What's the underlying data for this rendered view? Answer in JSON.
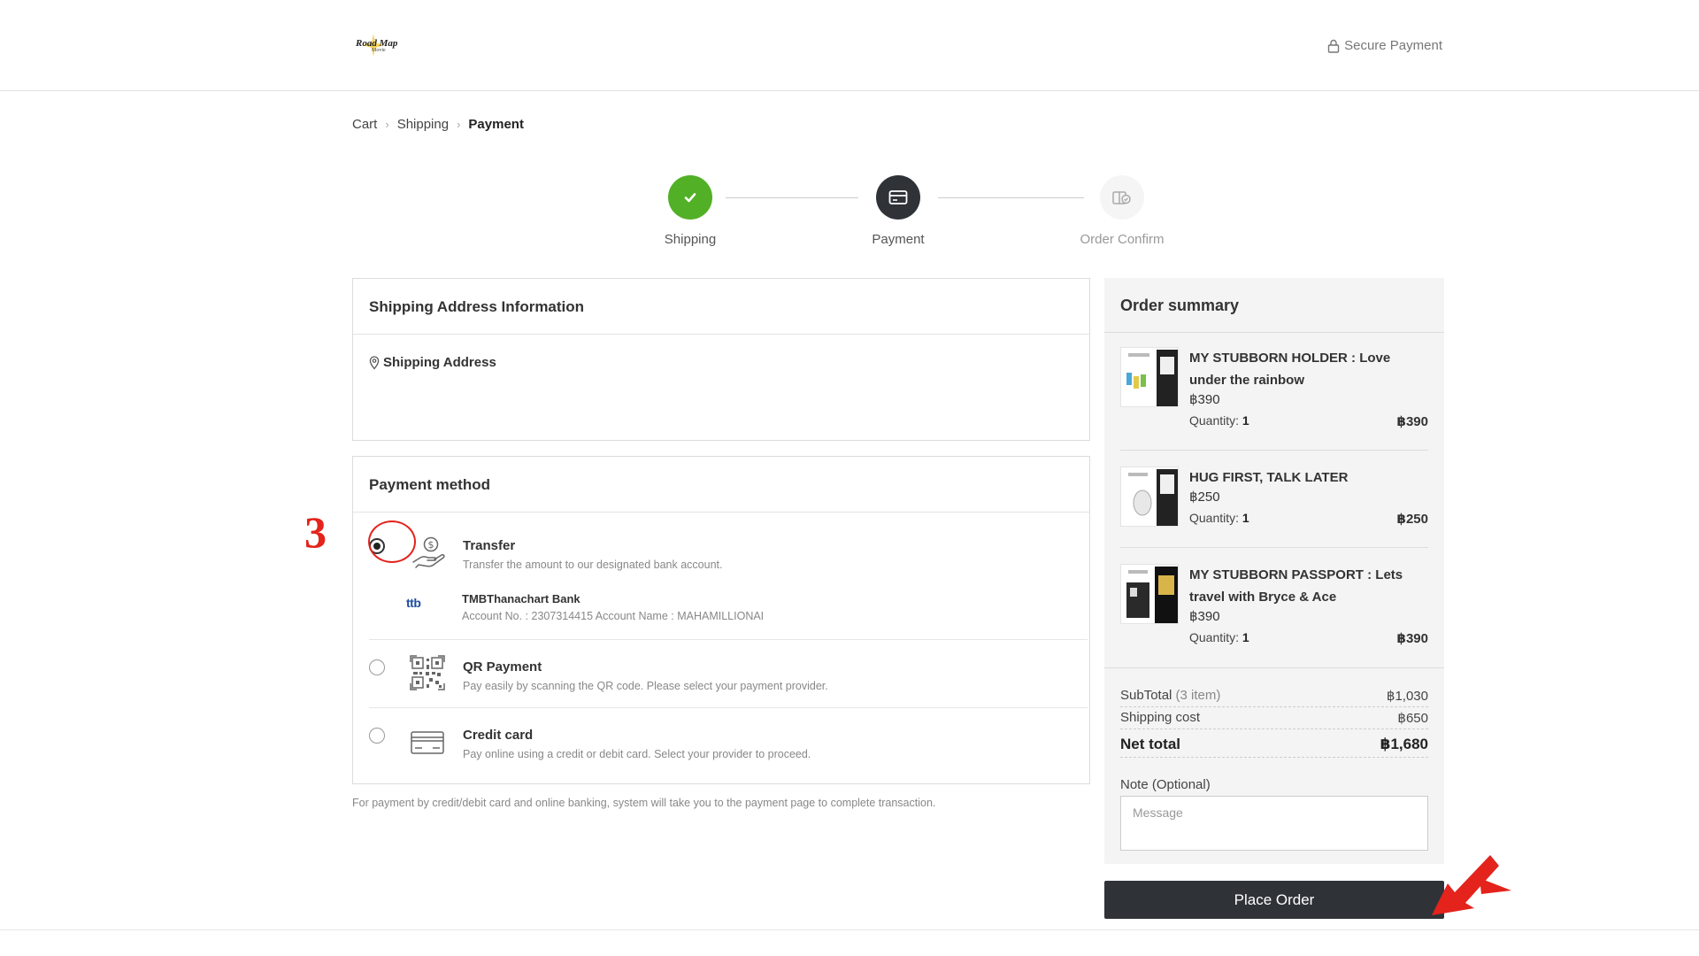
{
  "header": {
    "logo_text": "Road Map",
    "logo_sub": "Movie",
    "secure_label": "Secure Payment"
  },
  "breadcrumb": {
    "items": [
      "Cart",
      "Shipping",
      "Payment"
    ]
  },
  "stepper": {
    "steps": [
      {
        "label": "Shipping",
        "state": "done"
      },
      {
        "label": "Payment",
        "state": "active"
      },
      {
        "label": "Order Confirm",
        "state": "pending"
      }
    ]
  },
  "shipping": {
    "title": "Shipping Address Information",
    "address_label": "Shipping Address"
  },
  "payment": {
    "title": "Payment method",
    "options": [
      {
        "title": "Transfer",
        "desc": "Transfer the amount to our designated bank account.",
        "selected": true,
        "icon": "money-hand-icon"
      },
      {
        "title": "QR Payment",
        "desc": "Pay easily by scanning the QR code. Please select your payment provider.",
        "selected": false,
        "icon": "qr-code-icon"
      },
      {
        "title": "Credit card",
        "desc": "Pay online using a credit or debit card. Select your provider to proceed.",
        "selected": false,
        "icon": "credit-card-icon"
      }
    ],
    "bank": {
      "logo": "ttb",
      "name": "TMBThanachart Bank",
      "account": "Account No. : 2307314415 Account Name : MAHAMILLIONAI"
    },
    "footnote": "For payment by credit/debit card and online banking, system will take you to the payment page to complete transaction."
  },
  "summary": {
    "title": "Order summary",
    "items": [
      {
        "name": "MY STUBBORN HOLDER : Love under the rainbow",
        "price": "฿390",
        "qty_label": "Quantity:",
        "qty": "1",
        "total": "฿390"
      },
      {
        "name": "HUG FIRST, TALK LATER",
        "price": "฿250",
        "qty_label": "Quantity:",
        "qty": "1",
        "total": "฿250"
      },
      {
        "name": "MY STUBBORN PASSPORT : Lets travel with Bryce & Ace",
        "price": "฿390",
        "qty_label": "Quantity:",
        "qty": "1",
        "total": "฿390"
      }
    ],
    "subtotal_label": "SubTotal",
    "subtotal_count": "(3 item)",
    "subtotal_value": "฿1,030",
    "shipping_label": "Shipping cost",
    "shipping_value": "฿650",
    "net_label": "Net total",
    "net_value": "฿1,680",
    "note_label": "Note (Optional)",
    "note_placeholder": "Message"
  },
  "actions": {
    "place_order": "Place Order"
  },
  "annotation": {
    "step_number": "3"
  },
  "colors": {
    "step_done": "#52b026",
    "step_active": "#2f3338",
    "annotation": "#e3231c"
  }
}
